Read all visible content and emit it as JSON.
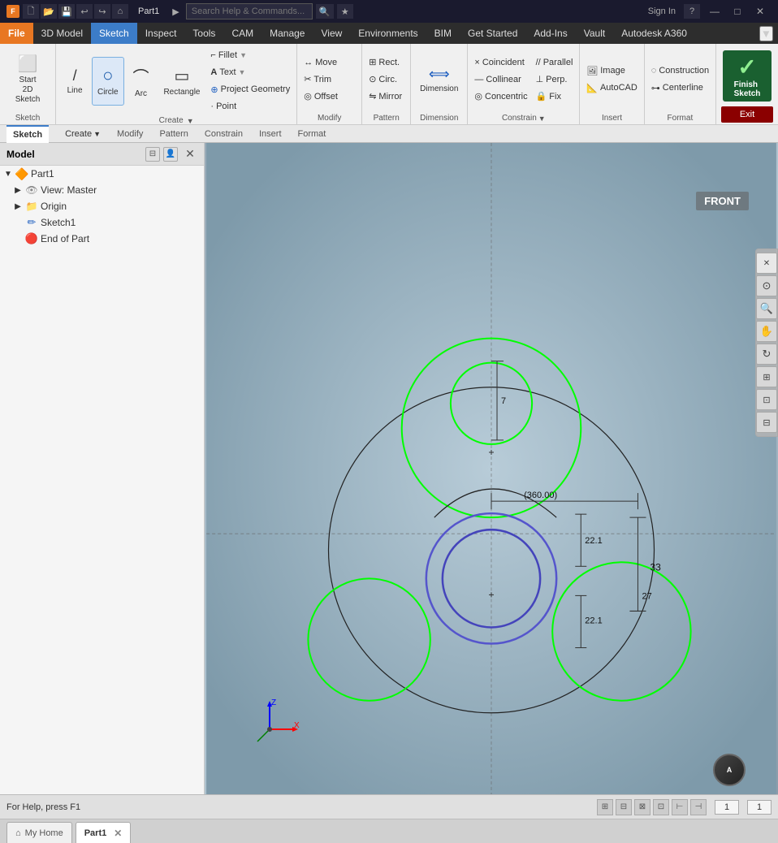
{
  "titlebar": {
    "app_icon": "F",
    "title": "Part1",
    "search_placeholder": "Search Help & Commands...",
    "sign_in": "Sign In",
    "help_label": "?",
    "minimize": "—",
    "maximize": "□",
    "close": "✕"
  },
  "menubar": {
    "items": [
      {
        "label": "File",
        "key": "file",
        "class": "file"
      },
      {
        "label": "3D Model",
        "key": "3d-model"
      },
      {
        "label": "Sketch",
        "key": "sketch",
        "class": "active"
      },
      {
        "label": "Inspect",
        "key": "inspect"
      },
      {
        "label": "Tools",
        "key": "tools"
      },
      {
        "label": "CAM",
        "key": "cam"
      },
      {
        "label": "Manage",
        "key": "manage"
      },
      {
        "label": "View",
        "key": "view"
      },
      {
        "label": "Environments",
        "key": "environments"
      },
      {
        "label": "BIM",
        "key": "bim"
      },
      {
        "label": "Get Started",
        "key": "get-started"
      },
      {
        "label": "Add-Ins",
        "key": "add-ins"
      },
      {
        "label": "Vault",
        "key": "vault"
      },
      {
        "label": "Autodesk A360",
        "key": "a360"
      }
    ]
  },
  "ribbon": {
    "sketch_group": {
      "label": "Sketch",
      "btn": {
        "label": "Start\n2D Sketch",
        "icon": "⬜"
      }
    },
    "create_group": {
      "label": "Create",
      "line": {
        "label": "Line",
        "icon": "/"
      },
      "circle": {
        "label": "Circle",
        "icon": "○"
      },
      "arc": {
        "label": "Arc",
        "icon": "⌒"
      },
      "rectangle": {
        "label": "Rectangle",
        "icon": "▭"
      },
      "fillet": {
        "label": "Fillet",
        "icon": "⌐"
      },
      "text": {
        "label": "Text",
        "icon": "A"
      },
      "project_geometry": {
        "label": "Project\nGeometry",
        "icon": "⬡"
      },
      "point": {
        "label": "Point",
        "icon": "·"
      }
    },
    "modify_group": {
      "label": "Modify"
    },
    "pattern_group": {
      "label": "Pattern"
    },
    "dimension_group": {
      "label": "Dimension",
      "btn": {
        "label": "Dimension",
        "icon": "⟺"
      }
    },
    "constrain_group": {
      "label": "Constrain"
    },
    "insert_group": {
      "label": "Insert"
    },
    "format_group": {
      "label": "Format"
    },
    "finish_btn": {
      "label": "Finish\nSketch",
      "icon": "✓"
    },
    "exit_btn": {
      "label": "Exit"
    }
  },
  "model_panel": {
    "title": "Model",
    "items": [
      {
        "label": "Part1",
        "icon": "part",
        "indent": 0,
        "expander": "▼"
      },
      {
        "label": "View: Master",
        "icon": "view",
        "indent": 1,
        "expander": "▶"
      },
      {
        "label": "Origin",
        "icon": "origin",
        "indent": 1,
        "expander": "▶"
      },
      {
        "label": "Sketch1",
        "icon": "sketch",
        "indent": 1,
        "expander": ""
      },
      {
        "label": "End of Part",
        "icon": "end",
        "indent": 1,
        "expander": ""
      }
    ]
  },
  "canvas": {
    "front_label": "FRONT",
    "view_label": "Front"
  },
  "side_toolbar": {
    "buttons": [
      {
        "icon": "✕",
        "name": "close-side"
      },
      {
        "icon": "⊙",
        "name": "zoom-fit"
      },
      {
        "icon": "🔍",
        "name": "zoom-in"
      },
      {
        "icon": "✋",
        "name": "pan"
      },
      {
        "icon": "↻",
        "name": "rotate"
      },
      {
        "icon": "⊞",
        "name": "view-cube"
      },
      {
        "icon": "⊡",
        "name": "appearance"
      },
      {
        "icon": "⊟",
        "name": "settings"
      }
    ]
  },
  "statusbar": {
    "help_text": "For Help, press F1",
    "coord1": "1",
    "coord2": "1",
    "icons": [
      "⊞",
      "⊟",
      "⊠",
      "⊡",
      "▲",
      "⊢"
    ]
  },
  "tabs": {
    "home": {
      "label": "My Home",
      "icon": "⌂"
    },
    "part1": {
      "label": "Part1",
      "closeable": true
    }
  }
}
